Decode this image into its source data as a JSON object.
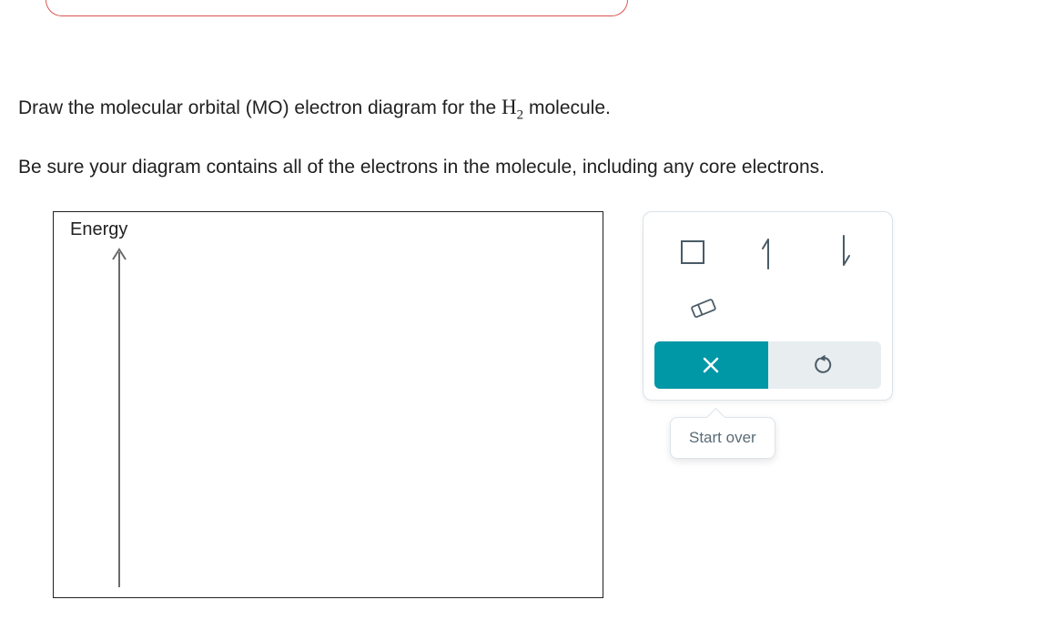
{
  "question": {
    "line1_pre": "Draw the molecular orbital (MO) electron diagram for the ",
    "formula_base": "H",
    "formula_sub": "2",
    "line1_post": " molecule.",
    "line2": "Be sure your diagram contains all of the electrons in the molecule, including any core electrons."
  },
  "diagram": {
    "axis_label": "Energy"
  },
  "palette": {
    "tools": {
      "box": "orbital-box",
      "up_arrow": "electron-up",
      "down_arrow": "electron-down",
      "eraser": "eraser"
    },
    "up_glyph": "↿",
    "down_glyph": "⇂"
  },
  "actions": {
    "clear": "×",
    "reset": "↺",
    "tooltip": "Start over"
  }
}
